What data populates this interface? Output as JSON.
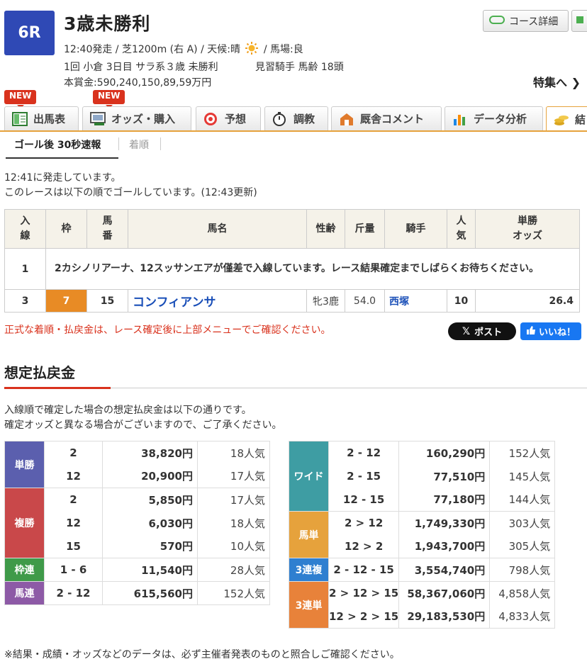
{
  "race": {
    "number": "6R",
    "title": "3歳未勝利",
    "line1": "12:40発走 / 芝1200m (右 A) / 天候:晴",
    "line1b": "/ 馬場:良",
    "line2": "1回 小倉 3日目 サラ系３歳 未勝利",
    "line2b": "見習騎手 馬齢 18頭",
    "line3": "本賞金:590,240,150,89,59万円"
  },
  "header": {
    "course_detail": "コース詳細",
    "tokushu": "特集へ"
  },
  "tabs": [
    {
      "label": "出馬表",
      "new": "NEW"
    },
    {
      "label": "オッズ・購入",
      "new": "NEW"
    },
    {
      "label": "予想"
    },
    {
      "label": "調教"
    },
    {
      "label": "厩舎コメント"
    },
    {
      "label": "データ分析"
    },
    {
      "label": "結"
    }
  ],
  "subtabs": [
    "ゴール後 30秒速報",
    "着順"
  ],
  "status": {
    "start": "12:41に発走しています。",
    "goal": "このレースは以下の順でゴールしています。(12:43更新)"
  },
  "results_table": {
    "headers": [
      "入線",
      "枠",
      "馬番",
      "馬名",
      "性齢",
      "斤量",
      "騎手",
      "人気",
      "単勝オッズ"
    ],
    "headers_split": {
      "h0a": "入",
      "h0b": "線",
      "h2a": "馬",
      "h2b": "番",
      "h7a": "人",
      "h7b": "気",
      "h8a": "単勝",
      "h8b": "オッズ"
    },
    "notice_row": {
      "pos": "1",
      "text": "2カシノリアーナ、12スッサンエアが僅差で入線しています。レース結果確定までしばらくお待ちください。"
    },
    "rows": [
      {
        "pos": "3",
        "waku": "7",
        "umaban": "15",
        "name": "コンフィアンサ",
        "sexage": "牝3鹿",
        "weight": "54.0",
        "jockey": "西塚",
        "pop": "10",
        "odds": "26.4"
      }
    ]
  },
  "warning": "正式な着順・払戻金は、レース確定後に上部メニューでご確認ください。",
  "share": {
    "x_post": "ポスト",
    "fb_like": "いいね！"
  },
  "payout": {
    "heading": "想定払戻金",
    "desc1": "入線順で確定した場合の想定払戻金は以下の通りです。",
    "desc2": "確定オッズと異なる場合がございますので、ご了承ください。",
    "left": [
      {
        "label": "単勝",
        "color": "#5b5fae",
        "rows": [
          [
            "2",
            "38,820円",
            "18人気"
          ],
          [
            "12",
            "20,900円",
            "17人気"
          ]
        ]
      },
      {
        "label": "複勝",
        "color": "#c9484a",
        "rows": [
          [
            "2",
            "5,850円",
            "17人気"
          ],
          [
            "12",
            "6,030円",
            "18人気"
          ],
          [
            "15",
            "570円",
            "10人気"
          ]
        ]
      },
      {
        "label": "枠連",
        "color": "#3f9a49",
        "rows": [
          [
            "1 - 6",
            "11,540円",
            "28人気"
          ]
        ]
      },
      {
        "label": "馬連",
        "color": "#8d5aa6",
        "rows": [
          [
            "2 - 12",
            "615,560円",
            "152人気"
          ]
        ]
      }
    ],
    "right": [
      {
        "label": "ワイド",
        "color": "#3e9da3",
        "rows": [
          [
            "2 - 12",
            "160,290円",
            "152人気"
          ],
          [
            "2 - 15",
            "77,510円",
            "145人気"
          ],
          [
            "12 - 15",
            "77,180円",
            "144人気"
          ]
        ]
      },
      {
        "label": "馬単",
        "color": "#e6a23c",
        "rows": [
          [
            "2 > 12",
            "1,749,330円",
            "303人気"
          ],
          [
            "12 > 2",
            "1,943,700円",
            "305人気"
          ]
        ]
      },
      {
        "label": "3連複",
        "color": "#2f7fd0",
        "rows": [
          [
            "2 - 12 - 15",
            "3,554,740円",
            "798人気"
          ]
        ]
      },
      {
        "label": "3連単",
        "color": "#e8823a",
        "rows": [
          [
            "2 > 12 > 15",
            "58,367,060円",
            "4,858人気"
          ],
          [
            "12 > 2 > 15",
            "29,183,530円",
            "4,833人気"
          ]
        ]
      }
    ]
  },
  "footnote": "※結果・成績・オッズなどのデータは、必ず主催者発表のものと照合しご確認ください。"
}
